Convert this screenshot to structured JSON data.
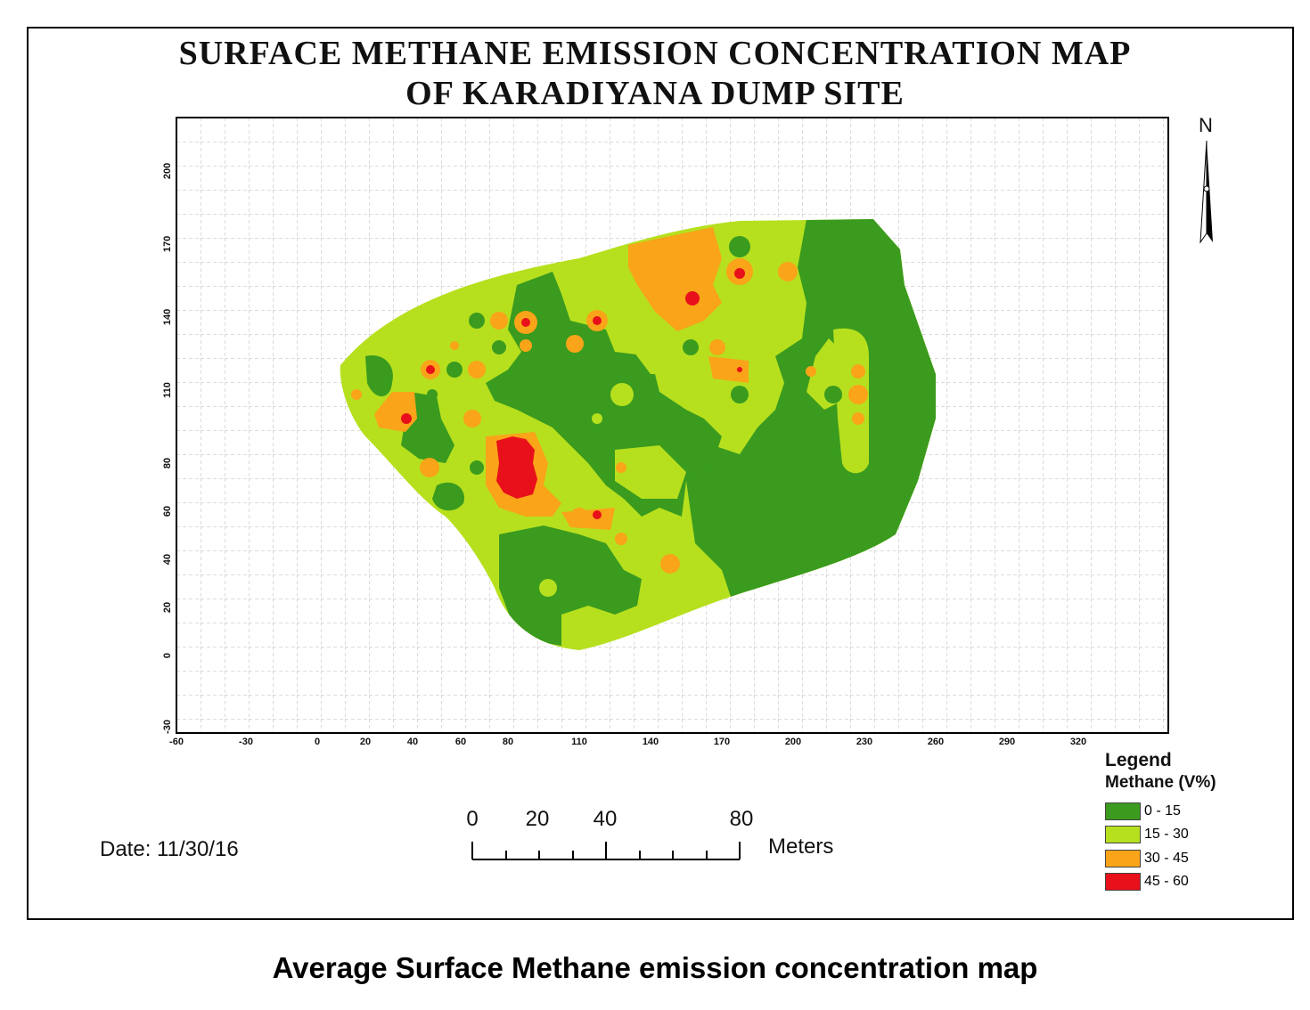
{
  "map": {
    "title_line1": "SURFACE METHANE EMISSION CONCENTRATION MAP",
    "title_line2": "OF KARADIYANA DUMP SITE",
    "date": "Date: 11/30/16",
    "north_label": "N",
    "x_ticks": [
      "-60",
      "-30",
      "0",
      "20",
      "40",
      "60",
      "80",
      "110",
      "140",
      "170",
      "200",
      "230",
      "260",
      "290",
      "320"
    ],
    "y_ticks": [
      "-30",
      "0",
      "20",
      "40",
      "60",
      "80",
      "110",
      "140",
      "170",
      "200"
    ],
    "scalebar": {
      "labels": [
        "0",
        "20",
        "40",
        "80"
      ],
      "units": "Meters"
    },
    "legend": {
      "title": "Legend",
      "subtitle": "Methane (V%)",
      "classes": [
        {
          "label": "0 - 15",
          "color": "#3a9b1e"
        },
        {
          "label": "15 - 30",
          "color": "#b6e01e"
        },
        {
          "label": "30 - 45",
          "color": "#f9a419"
        },
        {
          "label": "45 - 60",
          "color": "#e8101a"
        }
      ]
    }
  },
  "caption": "Average Surface Methane emission concentration map"
}
